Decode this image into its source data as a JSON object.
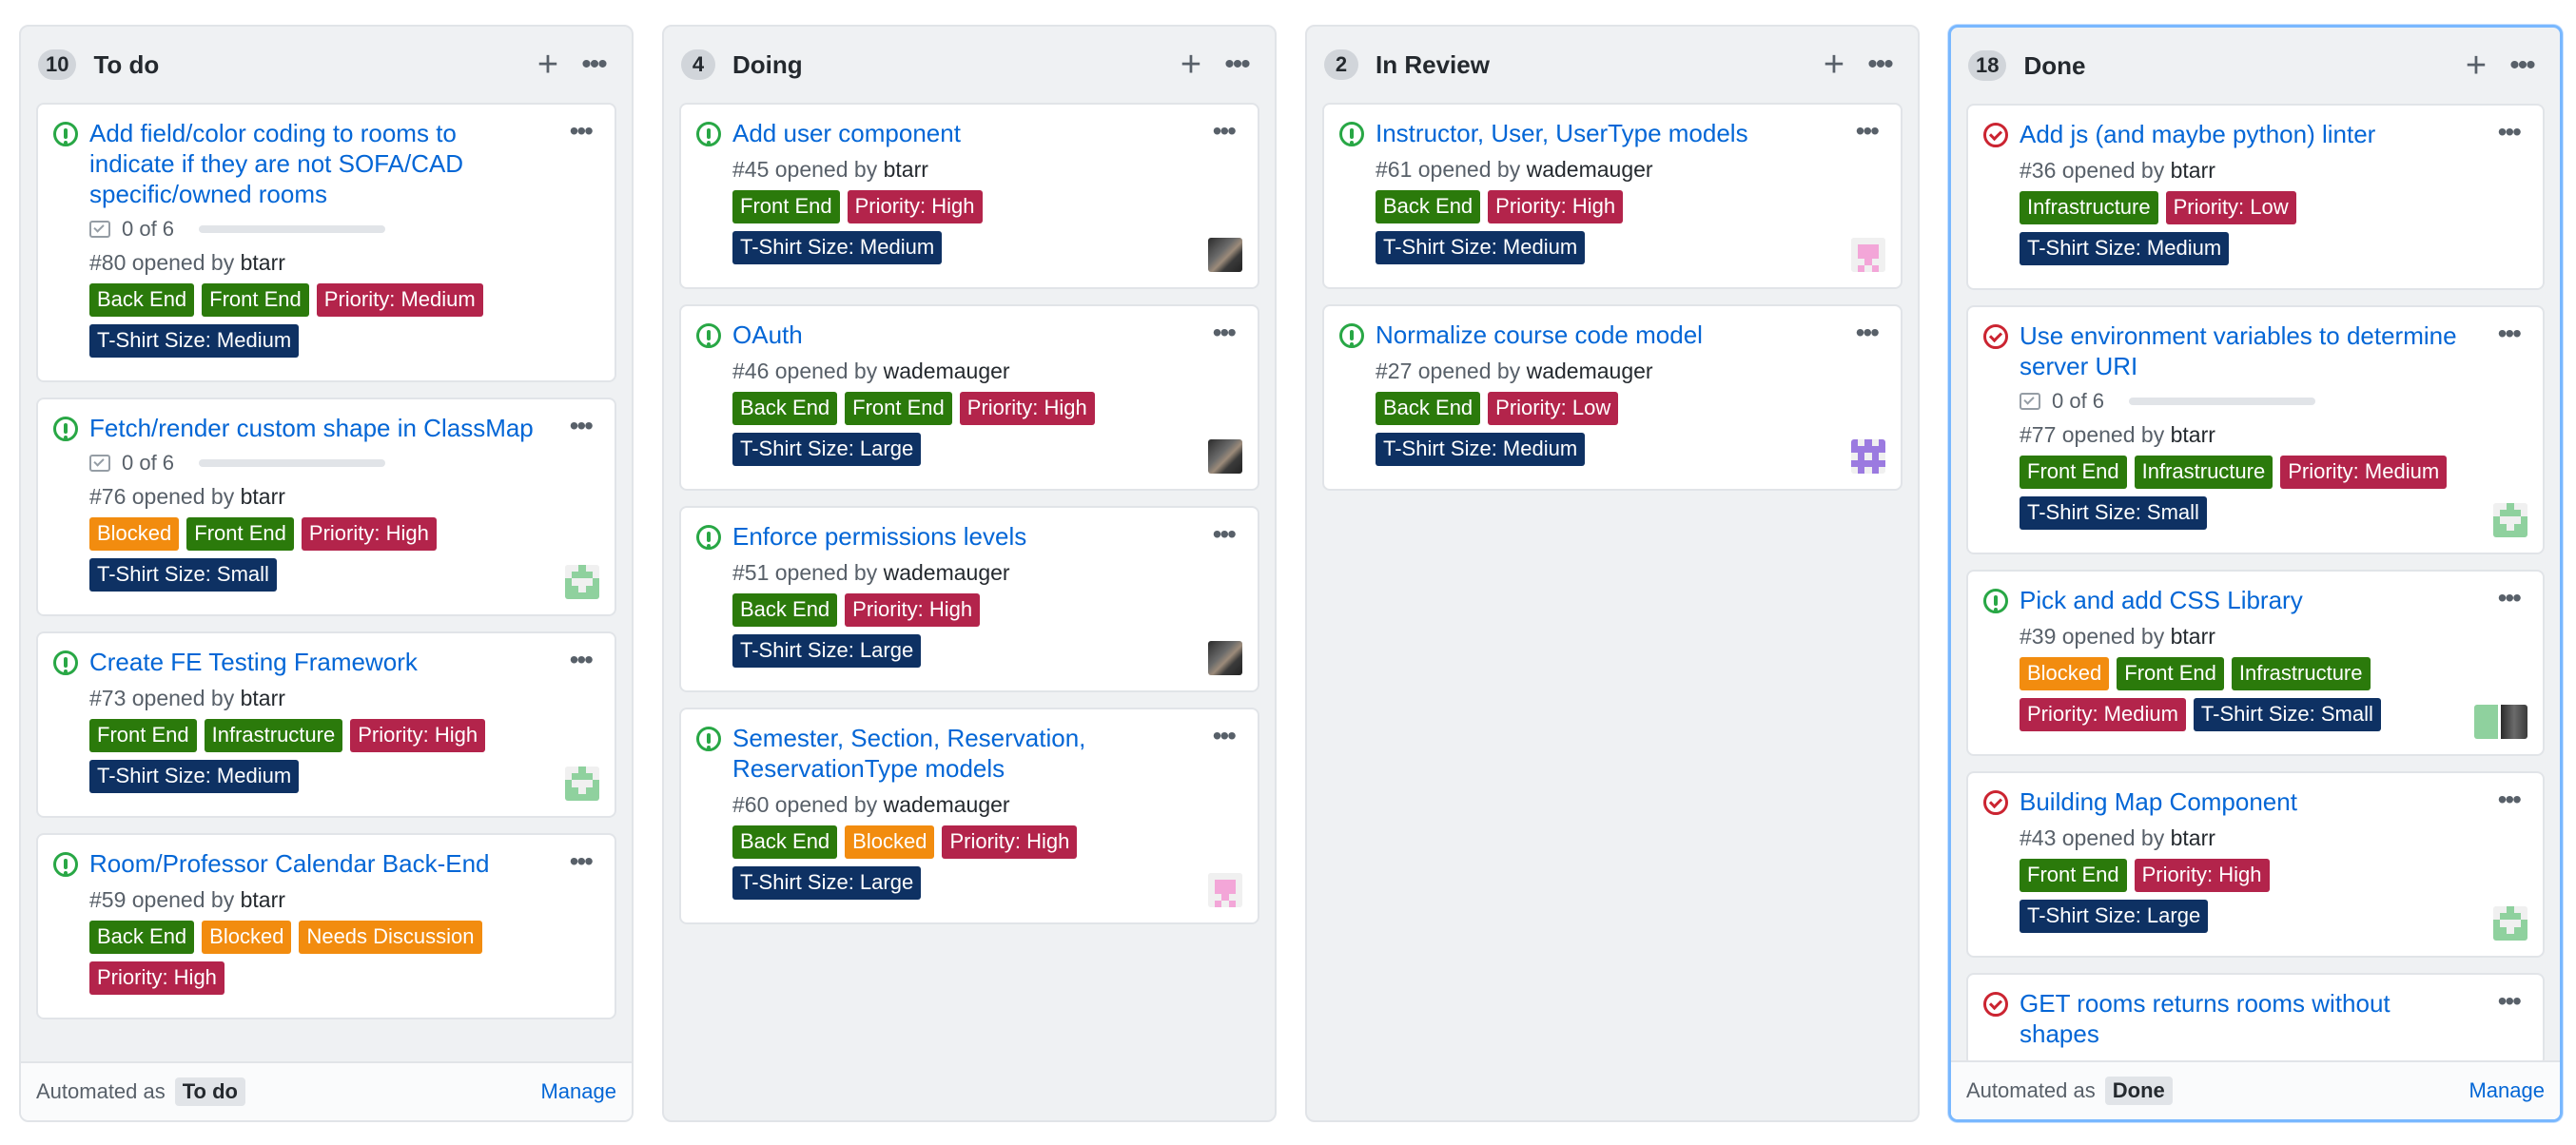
{
  "colors": {
    "back_end": "#2b7a0b",
    "front_end": "#2b7a0b",
    "infrastructure": "#2b7a0b",
    "priority_medium": "#b3244b",
    "priority_high": "#b3244b",
    "priority_low": "#b3244b",
    "tshirt": "#0e3163",
    "blocked": "#f28c0f",
    "needs_discussion": "#f28c0f"
  },
  "columns": [
    {
      "count": "10",
      "title": "To do",
      "footer_label": "Automated as",
      "footer_value": "To do",
      "manage": "Manage",
      "cards": [
        {
          "status": "open",
          "title": "Add field/color coding to rooms to indicate if they are not SOFA/CAD specific/owned rooms",
          "tasks": "0 of 6",
          "number": "#80",
          "opened_by": "opened by",
          "user": "btarr",
          "labels": [
            {
              "text": "Back End",
              "color": "#2b7a0b"
            },
            {
              "text": "Front End",
              "color": "#2b7a0b"
            },
            {
              "text": "Priority: Medium",
              "color": "#b3244b"
            },
            {
              "text": "T-Shirt Size: Medium",
              "color": "#0e3163"
            }
          ],
          "avatar": ""
        },
        {
          "status": "open",
          "title": "Fetch/render custom shape in ClassMap",
          "tasks": "0 of 6",
          "number": "#76",
          "opened_by": "opened by",
          "user": "btarr",
          "labels": [
            {
              "text": "Blocked",
              "color": "#f28c0f"
            },
            {
              "text": "Front End",
              "color": "#2b7a0b"
            },
            {
              "text": "Priority: High",
              "color": "#b3244b"
            },
            {
              "text": "T-Shirt Size: Small",
              "color": "#0e3163"
            }
          ],
          "avatar": "green"
        },
        {
          "status": "open",
          "title": "Create FE Testing Framework",
          "tasks": "",
          "number": "#73",
          "opened_by": "opened by",
          "user": "btarr",
          "labels": [
            {
              "text": "Front End",
              "color": "#2b7a0b"
            },
            {
              "text": "Infrastructure",
              "color": "#2b7a0b"
            },
            {
              "text": "Priority: High",
              "color": "#b3244b"
            },
            {
              "text": "T-Shirt Size: Medium",
              "color": "#0e3163"
            }
          ],
          "avatar": "green"
        },
        {
          "status": "open",
          "title": "Room/Professor Calendar Back-End",
          "tasks": "",
          "number": "#59",
          "opened_by": "opened by",
          "user": "btarr",
          "labels": [
            {
              "text": "Back End",
              "color": "#2b7a0b"
            },
            {
              "text": "Blocked",
              "color": "#f28c0f"
            },
            {
              "text": "Needs Discussion",
              "color": "#f28c0f"
            },
            {
              "text": "Priority: High",
              "color": "#b3244b"
            }
          ],
          "avatar": ""
        }
      ]
    },
    {
      "count": "4",
      "title": "Doing",
      "footer_label": "",
      "footer_value": "",
      "manage": "",
      "cards": [
        {
          "status": "open",
          "title": "Add user component",
          "tasks": "",
          "number": "#45",
          "opened_by": "opened by",
          "user": "btarr",
          "labels": [
            {
              "text": "Front End",
              "color": "#2b7a0b"
            },
            {
              "text": "Priority: High",
              "color": "#b3244b"
            },
            {
              "text": "T-Shirt Size: Medium",
              "color": "#0e3163"
            }
          ],
          "avatar": "photo"
        },
        {
          "status": "open",
          "title": "OAuth",
          "tasks": "",
          "number": "#46",
          "opened_by": "opened by",
          "user": "wademauger",
          "labels": [
            {
              "text": "Back End",
              "color": "#2b7a0b"
            },
            {
              "text": "Front End",
              "color": "#2b7a0b"
            },
            {
              "text": "Priority: High",
              "color": "#b3244b"
            },
            {
              "text": "T-Shirt Size: Large",
              "color": "#0e3163"
            }
          ],
          "avatar": "photo"
        },
        {
          "status": "open",
          "title": "Enforce permissions levels",
          "tasks": "",
          "number": "#51",
          "opened_by": "opened by",
          "user": "wademauger",
          "labels": [
            {
              "text": "Back End",
              "color": "#2b7a0b"
            },
            {
              "text": "Priority: High",
              "color": "#b3244b"
            },
            {
              "text": "T-Shirt Size: Large",
              "color": "#0e3163"
            }
          ],
          "avatar": "photo"
        },
        {
          "status": "open",
          "title": "Semester, Section, Reservation, ReservationType models",
          "tasks": "",
          "number": "#60",
          "opened_by": "opened by",
          "user": "wademauger",
          "labels": [
            {
              "text": "Back End",
              "color": "#2b7a0b"
            },
            {
              "text": "Blocked",
              "color": "#f28c0f"
            },
            {
              "text": "Priority: High",
              "color": "#b3244b"
            },
            {
              "text": "T-Shirt Size: Large",
              "color": "#0e3163"
            }
          ],
          "avatar": "pink"
        }
      ]
    },
    {
      "count": "2",
      "title": "In Review",
      "footer_label": "",
      "footer_value": "",
      "manage": "",
      "cards": [
        {
          "status": "open",
          "title": "Instructor, User, UserType models",
          "tasks": "",
          "number": "#61",
          "opened_by": "opened by",
          "user": "wademauger",
          "labels": [
            {
              "text": "Back End",
              "color": "#2b7a0b"
            },
            {
              "text": "Priority: High",
              "color": "#b3244b"
            },
            {
              "text": "T-Shirt Size: Medium",
              "color": "#0e3163"
            }
          ],
          "avatar": "pink"
        },
        {
          "status": "open",
          "title": "Normalize course code model",
          "tasks": "",
          "number": "#27",
          "opened_by": "opened by",
          "user": "wademauger",
          "labels": [
            {
              "text": "Back End",
              "color": "#2b7a0b"
            },
            {
              "text": "Priority: Low",
              "color": "#b3244b"
            },
            {
              "text": "T-Shirt Size: Medium",
              "color": "#0e3163"
            }
          ],
          "avatar": "purple"
        }
      ]
    },
    {
      "count": "18",
      "title": "Done",
      "footer_label": "Automated as",
      "footer_value": "Done",
      "manage": "Manage",
      "cards": [
        {
          "status": "closed",
          "title": "Add js (and maybe python) linter",
          "tasks": "",
          "number": "#36",
          "opened_by": "opened by",
          "user": "btarr",
          "labels": [
            {
              "text": "Infrastructure",
              "color": "#2b7a0b"
            },
            {
              "text": "Priority: Low",
              "color": "#b3244b"
            },
            {
              "text": "T-Shirt Size: Medium",
              "color": "#0e3163"
            }
          ],
          "avatar": ""
        },
        {
          "status": "closed",
          "title": "Use environment variables to determine server URI",
          "tasks": "0 of 6",
          "number": "#77",
          "opened_by": "opened by",
          "user": "btarr",
          "labels": [
            {
              "text": "Front End",
              "color": "#2b7a0b"
            },
            {
              "text": "Infrastructure",
              "color": "#2b7a0b"
            },
            {
              "text": "Priority: Medium",
              "color": "#b3244b"
            },
            {
              "text": "T-Shirt Size: Small",
              "color": "#0e3163"
            }
          ],
          "avatar": "green"
        },
        {
          "status": "open",
          "title": "Pick and add CSS Library",
          "tasks": "",
          "number": "#39",
          "opened_by": "opened by",
          "user": "btarr",
          "labels": [
            {
              "text": "Blocked",
              "color": "#f28c0f"
            },
            {
              "text": "Front End",
              "color": "#2b7a0b"
            },
            {
              "text": "Infrastructure",
              "color": "#2b7a0b"
            },
            {
              "text": "Priority: Medium",
              "color": "#b3244b"
            },
            {
              "text": "T-Shirt Size: Small",
              "color": "#0e3163"
            }
          ],
          "avatar": "double"
        },
        {
          "status": "closed",
          "title": "Building Map Component",
          "tasks": "",
          "number": "#43",
          "opened_by": "opened by",
          "user": "btarr",
          "labels": [
            {
              "text": "Front End",
              "color": "#2b7a0b"
            },
            {
              "text": "Priority: High",
              "color": "#b3244b"
            },
            {
              "text": "T-Shirt Size: Large",
              "color": "#0e3163"
            }
          ],
          "avatar": "green"
        },
        {
          "status": "closed",
          "title": "GET rooms returns rooms without shapes",
          "tasks": "",
          "number": "",
          "opened_by": "",
          "user": "",
          "labels": [],
          "avatar": ""
        }
      ]
    }
  ],
  "icons": {
    "add": "plus-icon",
    "menu": "kebab-icon",
    "open_issue": "issue-opened-icon",
    "closed_issue": "issue-closed-icon",
    "tasks": "task-list-icon"
  }
}
